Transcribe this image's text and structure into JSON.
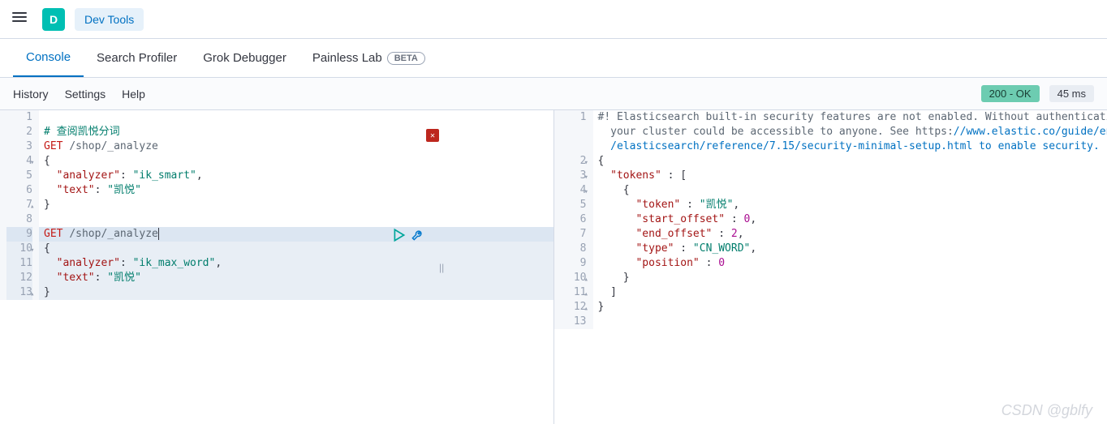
{
  "header": {
    "app_letter": "D",
    "breadcrumb": "Dev Tools"
  },
  "tabs": [
    {
      "id": "console",
      "label": "Console",
      "active": true
    },
    {
      "id": "search_profiler",
      "label": "Search Profiler",
      "active": false
    },
    {
      "id": "grok_debugger",
      "label": "Grok Debugger",
      "active": false
    },
    {
      "id": "painless_lab",
      "label": "Painless Lab",
      "active": false,
      "badge": "BETA"
    }
  ],
  "subbar": {
    "links": [
      "History",
      "Settings",
      "Help"
    ],
    "status": "200 - OK",
    "time": "45 ms"
  },
  "request": {
    "lines": [
      {
        "n": 1,
        "tokens": []
      },
      {
        "n": 2,
        "tokens": [
          {
            "t": "# 查阅凯悦分词",
            "c": "tok-comment"
          }
        ]
      },
      {
        "n": 3,
        "tokens": [
          {
            "t": "GET",
            "c": "tok-method"
          },
          {
            "t": " ",
            "c": ""
          },
          {
            "t": "/shop/_analyze",
            "c": "tok-path"
          }
        ]
      },
      {
        "n": 4,
        "fold": "▾",
        "tokens": [
          {
            "t": "{",
            "c": "tok-punc"
          }
        ]
      },
      {
        "n": 5,
        "tokens": [
          {
            "t": "  ",
            "c": ""
          },
          {
            "t": "\"analyzer\"",
            "c": "tok-key"
          },
          {
            "t": ": ",
            "c": "tok-punc"
          },
          {
            "t": "\"ik_smart\"",
            "c": "tok-str"
          },
          {
            "t": ",",
            "c": "tok-punc"
          }
        ]
      },
      {
        "n": 6,
        "tokens": [
          {
            "t": "  ",
            "c": ""
          },
          {
            "t": "\"text\"",
            "c": "tok-key"
          },
          {
            "t": ": ",
            "c": "tok-punc"
          },
          {
            "t": "\"凯悦\"",
            "c": "tok-str"
          }
        ]
      },
      {
        "n": 7,
        "fold": "▴",
        "tokens": [
          {
            "t": "}",
            "c": "tok-punc"
          }
        ]
      },
      {
        "n": 8,
        "tokens": []
      },
      {
        "n": 9,
        "hl": "strong",
        "cursor": true,
        "tokens": [
          {
            "t": "GET",
            "c": "tok-method"
          },
          {
            "t": " ",
            "c": ""
          },
          {
            "t": "/shop/_analyze",
            "c": "tok-path"
          }
        ]
      },
      {
        "n": 10,
        "fold": "▾",
        "hl": "soft",
        "tokens": [
          {
            "t": "{",
            "c": "tok-punc"
          }
        ]
      },
      {
        "n": 11,
        "hl": "soft",
        "tokens": [
          {
            "t": "  ",
            "c": ""
          },
          {
            "t": "\"analyzer\"",
            "c": "tok-key"
          },
          {
            "t": ": ",
            "c": "tok-punc"
          },
          {
            "t": "\"ik_max_word\"",
            "c": "tok-str"
          },
          {
            "t": ",",
            "c": "tok-punc"
          }
        ]
      },
      {
        "n": 12,
        "hl": "soft",
        "tokens": [
          {
            "t": "  ",
            "c": ""
          },
          {
            "t": "\"text\"",
            "c": "tok-key"
          },
          {
            "t": ": ",
            "c": "tok-punc"
          },
          {
            "t": "\"凯悦\"",
            "c": "tok-str"
          }
        ]
      },
      {
        "n": 13,
        "fold": "▴",
        "hl": "soft",
        "tokens": [
          {
            "t": "}",
            "c": "tok-punc"
          }
        ]
      }
    ]
  },
  "response": {
    "lines": [
      {
        "n": 1,
        "tokens": [
          {
            "t": "#! Elasticsearch built-in security features are not enabled. Without authentication,",
            "c": "tok-warn"
          }
        ]
      },
      {
        "n": "",
        "tokens": [
          {
            "t": "  your cluster could be accessible to anyone. See https:",
            "c": "tok-warn"
          },
          {
            "t": "//www.elastic.co/guide/en",
            "c": "tok-url"
          }
        ]
      },
      {
        "n": "",
        "tokens": [
          {
            "t": "  /elasticsearch/reference/7.15/security-minimal-setup.html to enable security.",
            "c": "tok-url"
          }
        ]
      },
      {
        "n": 2,
        "fold": "▾",
        "tokens": [
          {
            "t": "{",
            "c": "tok-punc"
          }
        ]
      },
      {
        "n": 3,
        "fold": "▾",
        "tokens": [
          {
            "t": "  ",
            "c": ""
          },
          {
            "t": "\"tokens\"",
            "c": "tok-key"
          },
          {
            "t": " : [",
            "c": "tok-punc"
          }
        ]
      },
      {
        "n": 4,
        "fold": "▾",
        "tokens": [
          {
            "t": "    {",
            "c": "tok-punc"
          }
        ]
      },
      {
        "n": 5,
        "tokens": [
          {
            "t": "      ",
            "c": ""
          },
          {
            "t": "\"token\"",
            "c": "tok-key"
          },
          {
            "t": " : ",
            "c": "tok-punc"
          },
          {
            "t": "\"凯悦\"",
            "c": "tok-str"
          },
          {
            "t": ",",
            "c": "tok-punc"
          }
        ]
      },
      {
        "n": 6,
        "tokens": [
          {
            "t": "      ",
            "c": ""
          },
          {
            "t": "\"start_offset\"",
            "c": "tok-key"
          },
          {
            "t": " : ",
            "c": "tok-punc"
          },
          {
            "t": "0",
            "c": "tok-num"
          },
          {
            "t": ",",
            "c": "tok-punc"
          }
        ]
      },
      {
        "n": 7,
        "tokens": [
          {
            "t": "      ",
            "c": ""
          },
          {
            "t": "\"end_offset\"",
            "c": "tok-key"
          },
          {
            "t": " : ",
            "c": "tok-punc"
          },
          {
            "t": "2",
            "c": "tok-num"
          },
          {
            "t": ",",
            "c": "tok-punc"
          }
        ]
      },
      {
        "n": 8,
        "tokens": [
          {
            "t": "      ",
            "c": ""
          },
          {
            "t": "\"type\"",
            "c": "tok-key"
          },
          {
            "t": " : ",
            "c": "tok-punc"
          },
          {
            "t": "\"CN_WORD\"",
            "c": "tok-str"
          },
          {
            "t": ",",
            "c": "tok-punc"
          }
        ]
      },
      {
        "n": 9,
        "tokens": [
          {
            "t": "      ",
            "c": ""
          },
          {
            "t": "\"position\"",
            "c": "tok-key"
          },
          {
            "t": " : ",
            "c": "tok-punc"
          },
          {
            "t": "0",
            "c": "tok-num"
          }
        ]
      },
      {
        "n": 10,
        "fold": "▴",
        "tokens": [
          {
            "t": "    }",
            "c": "tok-punc"
          }
        ]
      },
      {
        "n": 11,
        "fold": "▴",
        "tokens": [
          {
            "t": "  ]",
            "c": "tok-punc"
          }
        ]
      },
      {
        "n": 12,
        "fold": "▴",
        "tokens": [
          {
            "t": "}",
            "c": "tok-punc"
          }
        ]
      },
      {
        "n": 13,
        "tokens": []
      }
    ]
  },
  "watermark": "CSDN @gblfy"
}
